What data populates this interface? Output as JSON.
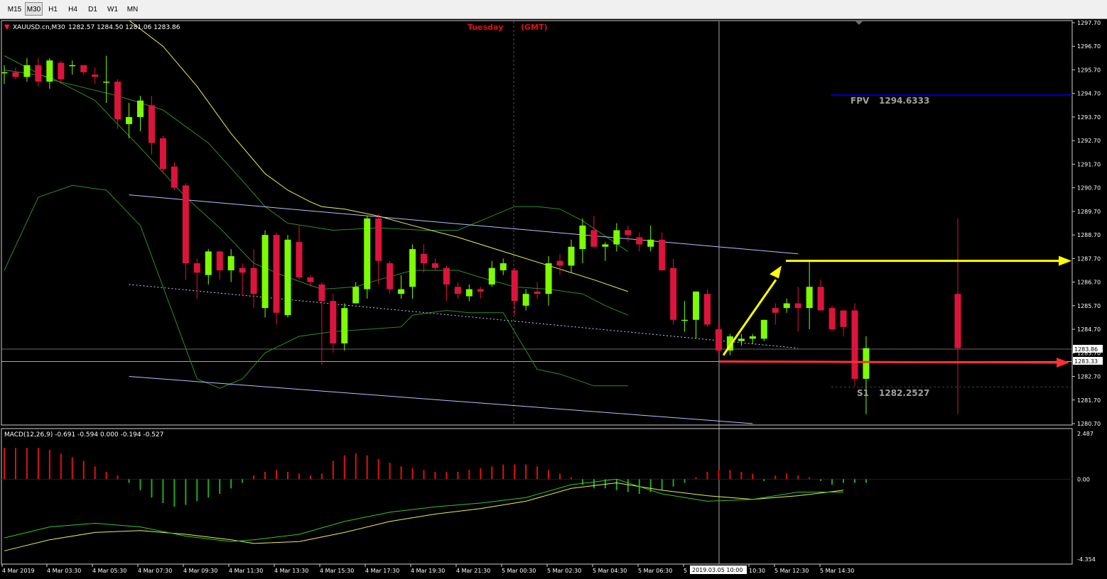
{
  "toolbar": {
    "timeframes": [
      "M15",
      "M30",
      "H1",
      "H4",
      "D1",
      "W1",
      "MN"
    ],
    "active": "M30"
  },
  "header": {
    "symbol": "XAUUSD.cn,M30",
    "ohlc": "1282.57 1284.50 1281.06 1283.86",
    "session": "Tuesday",
    "timezone": "(GMT)"
  },
  "annotations": {
    "fpv_label": "FPV",
    "fpv_value": "1294.6333",
    "s1_label": "S1",
    "s1_value": "1282.2527",
    "price_tag_1": "1283.86",
    "price_tag_2": "1283.33",
    "crosshair_time": "2019.03.05 10:00",
    "overlap_tag": "1283.70"
  },
  "macd": {
    "label": "MACD(12,26,9) -0.691 -0.594 0.000 -0.194 -0.527",
    "ticks": [
      "2.487",
      "0.00",
      "-4.354"
    ]
  },
  "colors": {
    "bull": "#7cfc00",
    "bear": "#dc143c",
    "fpv_line": "#0000ff",
    "arrow_yellow": "#ffff00",
    "arrow_red": "#ff3030",
    "channel": "#b0c4ff",
    "ma_yellow": "#eeee55",
    "band_green": "#2e8b2e"
  },
  "chart_data": {
    "type": "candlestick",
    "symbol": "XAUUSD.cn",
    "timeframe": "M30",
    "ylim": [
      1280.7,
      1297.7
    ],
    "y_ticks": [
      "1297.70",
      "1296.70",
      "1295.70",
      "1294.70",
      "1293.70",
      "1292.70",
      "1291.70",
      "1290.70",
      "1289.70",
      "1288.70",
      "1287.70",
      "1286.70",
      "1285.70",
      "1284.70",
      "1283.70",
      "1282.70",
      "1281.70",
      "1280.70"
    ],
    "x_ticks": [
      "4 Mar 2019",
      "4 Mar 03:30",
      "4 Mar 05:30",
      "4 Mar 07:30",
      "4 Mar 09:30",
      "4 Mar 11:30",
      "4 Mar 13:30",
      "4 Mar 15:30",
      "4 Mar 17:30",
      "4 Mar 19:30",
      "4 Mar 21:30",
      "5 Mar 00:30",
      "5 Mar 02:30",
      "5 Mar 04:30",
      "5 Mar 06:30",
      "5",
      "10:30",
      "5 Mar 12:30",
      "5 Mar 14:30"
    ],
    "candles": [
      [
        1295.6,
        1295.9,
        1295.1,
        1295.6
      ],
      [
        1295.6,
        1295.8,
        1295.3,
        1295.4
      ],
      [
        1295.4,
        1296.2,
        1295.2,
        1295.9
      ],
      [
        1295.9,
        1296.2,
        1295.0,
        1295.2
      ],
      [
        1295.2,
        1296.2,
        1294.9,
        1296.1
      ],
      [
        1296.0,
        1296.1,
        1295.1,
        1295.3
      ],
      [
        1295.9,
        1296.1,
        1295.5,
        1295.9
      ],
      [
        1295.9,
        1295.9,
        1295.5,
        1295.6
      ],
      [
        1295.5,
        1295.8,
        1295.1,
        1295.4
      ],
      [
        1295.2,
        1296.3,
        1294.3,
        1295.2
      ],
      [
        1295.2,
        1295.3,
        1293.2,
        1293.6
      ],
      [
        1293.4,
        1294.3,
        1292.8,
        1293.7
      ],
      [
        1293.7,
        1294.6,
        1293.1,
        1294.4
      ],
      [
        1294.2,
        1294.6,
        1292.1,
        1292.6
      ],
      [
        1292.8,
        1292.9,
        1291.3,
        1291.5
      ],
      [
        1291.6,
        1291.8,
        1290.6,
        1290.7
      ],
      [
        1290.8,
        1290.9,
        1286.8,
        1287.5
      ],
      [
        1287.5,
        1287.7,
        1286.0,
        1287.1
      ],
      [
        1287.0,
        1288.1,
        1286.6,
        1288.0
      ],
      [
        1288.0,
        1288.0,
        1286.8,
        1287.2
      ],
      [
        1287.2,
        1288.1,
        1286.7,
        1287.8
      ],
      [
        1287.3,
        1287.5,
        1286.1,
        1287.1
      ],
      [
        1287.3,
        1288.1,
        1285.6,
        1286.2
      ],
      [
        1285.6,
        1288.9,
        1285.2,
        1288.7
      ],
      [
        1288.7,
        1288.8,
        1284.9,
        1285.4
      ],
      [
        1285.3,
        1288.7,
        1285.2,
        1288.5
      ],
      [
        1288.4,
        1289.1,
        1286.8,
        1286.9
      ],
      [
        1286.9,
        1287.0,
        1286.5,
        1286.7
      ],
      [
        1286.6,
        1286.7,
        1283.2,
        1285.9
      ],
      [
        1285.9,
        1286.2,
        1283.7,
        1284.1
      ],
      [
        1284.1,
        1285.8,
        1283.8,
        1285.6
      ],
      [
        1285.8,
        1286.7,
        1285.8,
        1286.5
      ],
      [
        1286.4,
        1289.5,
        1286.0,
        1289.4
      ],
      [
        1289.4,
        1289.6,
        1286.6,
        1287.6
      ],
      [
        1287.5,
        1287.6,
        1286.2,
        1286.4
      ],
      [
        1286.2,
        1287.0,
        1286.0,
        1286.4
      ],
      [
        1286.5,
        1288.3,
        1286.0,
        1288.1
      ],
      [
        1287.9,
        1288.3,
        1287.1,
        1287.5
      ],
      [
        1287.5,
        1287.7,
        1287.2,
        1287.3
      ],
      [
        1287.3,
        1287.4,
        1285.9,
        1286.6
      ],
      [
        1286.5,
        1286.7,
        1286.0,
        1286.2
      ],
      [
        1286.1,
        1286.6,
        1285.9,
        1286.4
      ],
      [
        1286.4,
        1286.5,
        1286.0,
        1286.3
      ],
      [
        1286.6,
        1287.6,
        1286.5,
        1287.3
      ],
      [
        1287.2,
        1287.7,
        1287.0,
        1287.5
      ],
      [
        1287.2,
        1287.3,
        1285.3,
        1285.9
      ],
      [
        1285.7,
        1286.4,
        1285.5,
        1286.2
      ],
      [
        1286.3,
        1286.7,
        1286.0,
        1286.2
      ],
      [
        1286.2,
        1287.8,
        1285.7,
        1287.5
      ],
      [
        1287.6,
        1287.9,
        1287.0,
        1287.4
      ],
      [
        1287.4,
        1288.5,
        1287.1,
        1288.2
      ],
      [
        1288.1,
        1289.4,
        1287.5,
        1289.1
      ],
      [
        1288.9,
        1289.5,
        1288.2,
        1288.2
      ],
      [
        1288.2,
        1288.4,
        1287.6,
        1288.3
      ],
      [
        1288.3,
        1289.2,
        1288.0,
        1288.9
      ],
      [
        1288.9,
        1289.1,
        1288.4,
        1288.7
      ],
      [
        1288.6,
        1288.8,
        1288.0,
        1288.3
      ],
      [
        1288.2,
        1289.1,
        1288.0,
        1288.5
      ],
      [
        1288.5,
        1288.8,
        1287.2,
        1287.2
      ],
      [
        1287.3,
        1287.7,
        1284.9,
        1285.1
      ],
      [
        1285.1,
        1285.9,
        1284.6,
        1285.1
      ],
      [
        1285.1,
        1286.3,
        1284.3,
        1286.3
      ],
      [
        1286.2,
        1286.4,
        1284.8,
        1284.9
      ],
      [
        1284.7,
        1285.0,
        1283.7,
        1283.8
      ],
      [
        1283.8,
        1284.5,
        1283.6,
        1284.4
      ],
      [
        1284.2,
        1284.5,
        1284.0,
        1284.3
      ],
      [
        1284.3,
        1284.5,
        1284.1,
        1284.4
      ],
      [
        1284.3,
        1285.1,
        1284.2,
        1285.1
      ],
      [
        1285.6,
        1285.8,
        1284.9,
        1285.4
      ],
      [
        1285.6,
        1286.0,
        1285.4,
        1285.8
      ],
      [
        1285.8,
        1286.5,
        1284.6,
        1285.6
      ],
      [
        1285.6,
        1287.6,
        1284.7,
        1286.5
      ],
      [
        1286.5,
        1286.8,
        1285.5,
        1285.5
      ],
      [
        1285.6,
        1285.7,
        1284.6,
        1284.7
      ],
      [
        1285.5,
        1285.5,
        1284.4,
        1284.8
      ],
      [
        1285.5,
        1285.8,
        1282.3,
        1282.6
      ],
      [
        1282.6,
        1284.4,
        1281.1,
        1283.9
      ]
    ],
    "moving_averages": {
      "yellow": [
        [
          11,
          1297.8
        ],
        [
          14,
          1296.7
        ],
        [
          17,
          1295.0
        ],
        [
          20,
          1293.0
        ],
        [
          23,
          1291.3
        ],
        [
          25,
          1290.6
        ],
        [
          27,
          1290.1
        ],
        [
          28,
          1289.9
        ],
        [
          30,
          1289.8
        ],
        [
          33,
          1289.5
        ],
        [
          36,
          1289.1
        ],
        [
          40,
          1288.6
        ],
        [
          44,
          1288.0
        ],
        [
          48,
          1287.4
        ],
        [
          52,
          1286.8
        ],
        [
          55,
          1286.3
        ]
      ],
      "upper_band": [
        [
          0,
          1296.3
        ],
        [
          4,
          1295.3
        ],
        [
          10,
          1294.6
        ],
        [
          14,
          1294.0
        ],
        [
          18,
          1292.6
        ],
        [
          21,
          1291.0
        ],
        [
          23,
          1289.9
        ],
        [
          25,
          1289.2
        ],
        [
          29,
          1288.9
        ],
        [
          33,
          1289.0
        ],
        [
          37,
          1288.9
        ],
        [
          40,
          1288.9
        ],
        [
          42,
          1289.3
        ],
        [
          45,
          1289.9
        ],
        [
          47,
          1289.9
        ],
        [
          49,
          1289.8
        ],
        [
          51,
          1289.3
        ],
        [
          55,
          1288.0
        ]
      ],
      "middle_band": [
        [
          0,
          1295.7
        ],
        [
          4,
          1295.4
        ],
        [
          8,
          1294.4
        ],
        [
          12,
          1292.4
        ],
        [
          16,
          1290.3
        ],
        [
          19,
          1289.0
        ],
        [
          22,
          1287.5
        ],
        [
          25,
          1286.9
        ],
        [
          28,
          1286.4
        ],
        [
          31,
          1286.5
        ],
        [
          33,
          1286.8
        ],
        [
          36,
          1287.2
        ],
        [
          40,
          1287.2
        ],
        [
          42,
          1286.9
        ],
        [
          45,
          1286.5
        ],
        [
          48,
          1286.4
        ],
        [
          51,
          1286.2
        ],
        [
          53,
          1285.7
        ],
        [
          55,
          1285.3
        ]
      ],
      "lower_band": [
        [
          0,
          1287.2
        ],
        [
          3,
          1290.3
        ],
        [
          6,
          1290.8
        ],
        [
          9,
          1290.6
        ],
        [
          12,
          1289.1
        ],
        [
          15,
          1285.2
        ],
        [
          17,
          1282.6
        ],
        [
          19,
          1282.2
        ],
        [
          21,
          1282.6
        ],
        [
          23,
          1283.7
        ],
        [
          26,
          1284.4
        ],
        [
          29,
          1284.6
        ],
        [
          32,
          1284.7
        ],
        [
          35,
          1284.8
        ],
        [
          36,
          1285.3
        ],
        [
          39,
          1285.5
        ],
        [
          41,
          1285.4
        ],
        [
          44,
          1285.4
        ],
        [
          47,
          1283.0
        ],
        [
          49,
          1282.8
        ],
        [
          52,
          1282.3
        ],
        [
          55,
          1282.3
        ]
      ]
    },
    "trendlines": {
      "channel_upper": [
        [
          11,
          1290.4
        ],
        [
          70,
          1287.9
        ]
      ],
      "channel_lower": [
        [
          11,
          1282.7
        ],
        [
          66,
          1280.7
        ]
      ],
      "channel_mid": [
        [
          11,
          1286.6
        ],
        [
          70,
          1283.9
        ]
      ],
      "fpv": 1294.6333,
      "s1": 1282.2527
    },
    "macd": {
      "params": "12,26,9",
      "main": -0.691,
      "signal": -0.594,
      "hist": [
        1.7,
        1.7,
        1.7,
        1.7,
        1.6,
        1.4,
        1.2,
        1.0,
        0.7,
        0.4,
        0.2,
        -0.2,
        -0.6,
        -1.0,
        -1.3,
        -1.5,
        -1.4,
        -1.2,
        -1.0,
        -0.8,
        -0.5,
        -0.2,
        0.2,
        0.4,
        0.5,
        0.4,
        0.3,
        0.2,
        0.3,
        1.0,
        1.3,
        1.4,
        1.3,
        1.1,
        0.9,
        0.7,
        0.6,
        0.5,
        0.4,
        0.4,
        0.4,
        0.5,
        0.6,
        0.7,
        0.8,
        0.8,
        0.8,
        0.7,
        0.5,
        0.3,
        0.1,
        -0.3,
        -0.5,
        -0.5,
        -0.6,
        -0.7,
        -0.8,
        -0.7,
        -0.6,
        -0.4,
        -0.2,
        0.1,
        0.4,
        0.5,
        0.5,
        0.4,
        0.3,
        -0.1,
        0.2,
        0.3,
        0.2,
        0.1,
        -0.1,
        -0.3,
        -0.2,
        -0.2,
        -0.2
      ]
    }
  }
}
